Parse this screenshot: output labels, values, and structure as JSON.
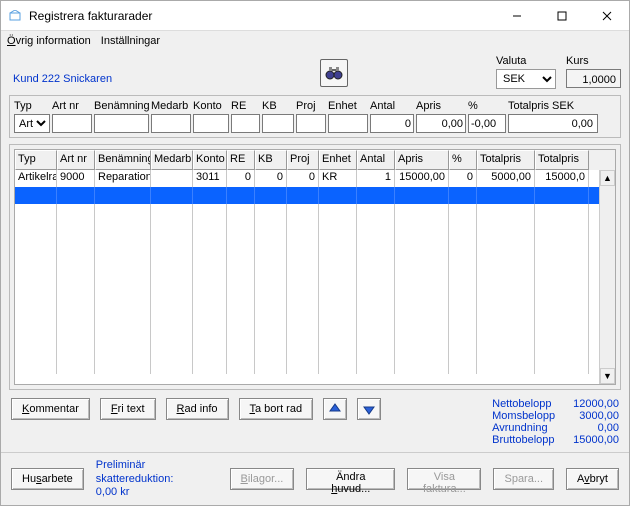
{
  "window": {
    "title": "Registrera fakturarader"
  },
  "menu": {
    "ovrig": "Övrig information",
    "installningar": "Inställningar"
  },
  "customer": "Kund 222 Snickaren",
  "valuta": {
    "label": "Valuta",
    "value": "SEK"
  },
  "kurs": {
    "label": "Kurs",
    "value": "1,0000"
  },
  "entry": {
    "headers": {
      "typ": "Typ",
      "artnr": "Art nr",
      "benamning": "Benämning",
      "medarb": "Medarb",
      "konto": "Konto",
      "re": "RE",
      "kb": "KB",
      "proj": "Proj",
      "enhet": "Enhet",
      "antal": "Antal",
      "apris": "Apris",
      "pct": "%",
      "totalpris": "Totalpris SEK"
    },
    "values": {
      "typ": "Arti",
      "artnr": "",
      "benamning": "",
      "medarb": "",
      "konto": "",
      "re": "",
      "kb": "",
      "proj": "",
      "enhet": "",
      "antal": "0",
      "apris": "0,00",
      "pct": "-0,00",
      "totalpris": "0,00"
    }
  },
  "table": {
    "headers": {
      "typ": "Typ",
      "artnr": "Art nr",
      "benamning": "Benämning",
      "medarb": "Medarb",
      "konto": "Konto",
      "re": "RE",
      "kb": "KB",
      "proj": "Proj",
      "enhet": "Enhet",
      "antal": "Antal",
      "apris": "Apris",
      "pct": "%",
      "totalpris": "Totalpris",
      "totalpris2": "Totalpris"
    },
    "rows": [
      {
        "typ": "Artikelra",
        "artnr": "9000",
        "benamning": "Reparation",
        "medarb": "",
        "konto": "3011",
        "re": "0",
        "kb": "0",
        "proj": "0",
        "enhet": "KR",
        "antal": "1",
        "apris": "15000,00",
        "pct": "0",
        "totalpris": "5000,00",
        "totalpris2": "15000,0"
      },
      {
        "typ": "",
        "artnr": "",
        "benamning": "",
        "medarb": "",
        "konto": "",
        "re": "",
        "kb": "",
        "proj": "",
        "enhet": "",
        "antal": "",
        "apris": "",
        "pct": "",
        "totalpris": "",
        "totalpris2": ""
      }
    ]
  },
  "row_buttons": {
    "kommentar": "Kommentar",
    "fritext": "Fri text",
    "radinfo": "Rad info",
    "tabort": "Ta bort rad"
  },
  "totals": {
    "netto_label": "Nettobelopp",
    "netto": "12000,00",
    "moms_label": "Momsbelopp",
    "moms": "3000,00",
    "avr_label": "Avrundning",
    "avr": "0,00",
    "brutto_label": "Bruttobelopp",
    "brutto": "15000,00"
  },
  "bottom": {
    "husarbete": "Husarbete",
    "prelim_label": "Preliminär skattereduktion:",
    "prelim_value": "0,00 kr",
    "bilagor": "Bilagor...",
    "andra": "Ändra huvud...",
    "visa": "Visa faktura...",
    "spara": "Spara...",
    "avbryt": "Avbryt"
  }
}
